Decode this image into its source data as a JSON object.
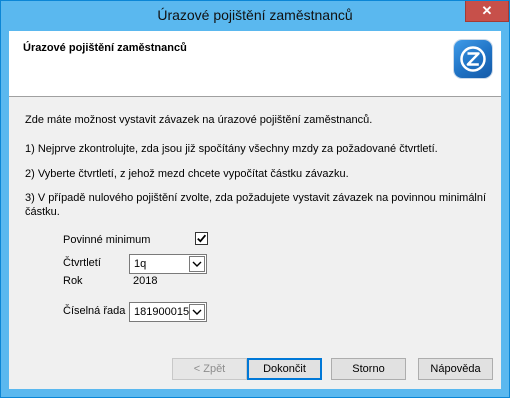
{
  "window": {
    "title": "Úrazové pojištění zaměstnanců",
    "close_glyph": "✕"
  },
  "header": {
    "title": "Úrazové pojištění zaměstnanců",
    "logo_icon": "z-logo-icon"
  },
  "body": {
    "intro": "Zde máte možnost vystavit závazek na úrazové pojištění zaměstnanců.",
    "step1": "1) Nejprve zkontrolujte, zda jsou již spočítány všechny mzdy za požadované čtvrtletí.",
    "step2": "2) Vyberte čtvrtletí, z jehož mezd chcete vypočítat částku závazku.",
    "step3_line1": "3) V případě nulového pojištění zvolte, zda požadujete vystavit závazek na povinnou minimální",
    "step3_line2": "částku."
  },
  "form": {
    "minimum_label": "Povinné minimum",
    "minimum_checked": true,
    "quarter_label": "Čtvrtletí",
    "quarter_value": "1q",
    "year_label": "Rok",
    "year_value": "2018",
    "series_label": "Číselná řada",
    "series_value": "181900015"
  },
  "buttons": {
    "back": "< Zpět",
    "finish": "Dokončit",
    "cancel": "Storno",
    "help": "Nápověda"
  },
  "colors": {
    "titlebar": "#5ab8ef",
    "close": "#c7504a",
    "accent": "#0078d7"
  }
}
